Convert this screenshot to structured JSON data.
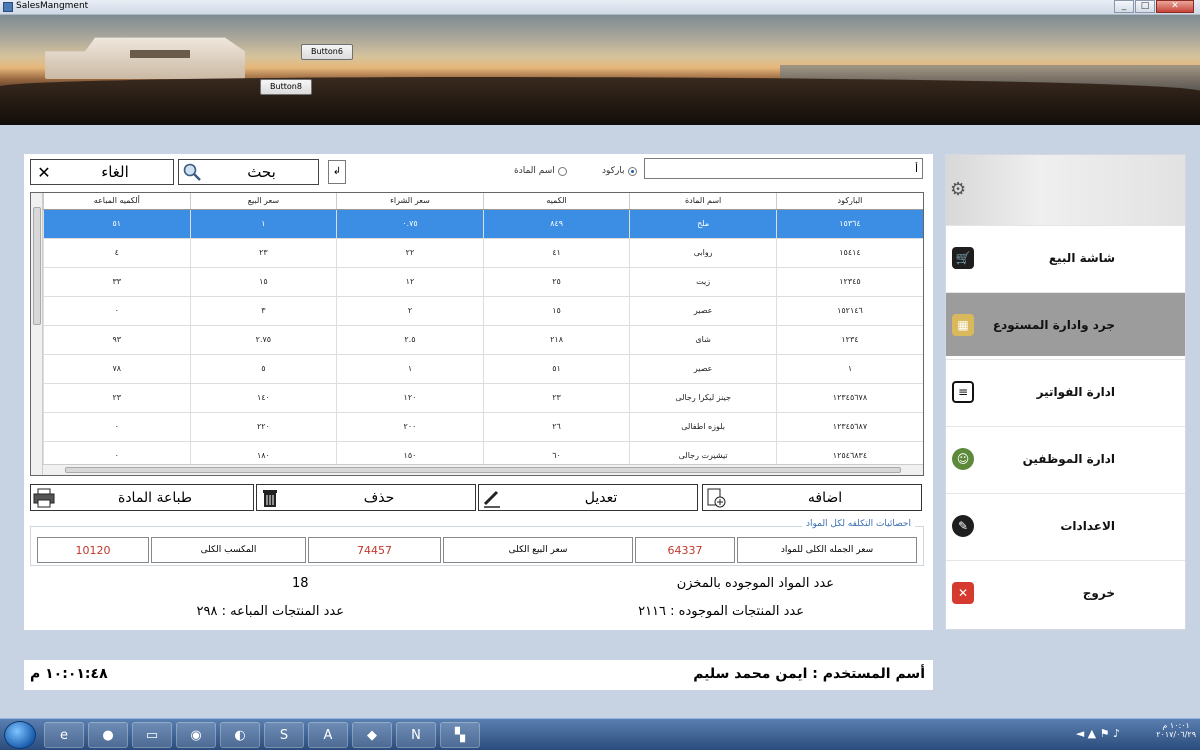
{
  "window": {
    "title": "SalesMangment",
    "controls": [
      "_",
      "□",
      "✕"
    ]
  },
  "header": {
    "button6_label": "Button6",
    "button8_label": "Button8"
  },
  "search": {
    "value": "أ",
    "radio_barcode": "باركود",
    "radio_name": "اسم المادة",
    "selected": "barcode",
    "search_label": "بحث",
    "cancel_label": "الغاء",
    "clear_label": "↲"
  },
  "table": {
    "columns": [
      "الباركود",
      "اسم المادة",
      "الكميه",
      "سعر الشراء",
      "سعر البيع",
      "ألكميه المباعه"
    ],
    "rows": [
      [
        "١٥٣٦٤",
        "ملح",
        "٨٤٩",
        "٠.٧٥",
        "١",
        "٥١"
      ],
      [
        "١٥٤١٤",
        "روابى",
        "٤١",
        "٢٢",
        "٢٣",
        "٤"
      ],
      [
        "١٢٣٤٥",
        "زيت",
        "٢٥",
        "١٢",
        "١٥",
        "٣٣"
      ],
      [
        "١٥٢١٤٦",
        "عصير",
        "١٥",
        "٢",
        "٣",
        "٠"
      ],
      [
        "١٢٣٤",
        "شاى",
        "٢١٨",
        "٢.٥",
        "٢.٧٥",
        "٩٣"
      ],
      [
        "١",
        "عصير",
        "٥١",
        "١",
        "٥",
        "٧٨"
      ],
      [
        "١٢٣٤٥٦٧٨",
        "جينز ليكرا رجالى",
        "٢٣",
        "١٢٠",
        "١٤٠",
        "٢٣"
      ],
      [
        "١٢٣٤٥٦٨٧",
        "بلوزه اطفالى",
        "٢٦",
        "٢٠٠",
        "٢٢٠",
        "٠"
      ],
      [
        "١٢٥٤٦٨٣٤",
        "تيشيرت رجالى",
        "٦٠",
        "١٥٠",
        "١٨٠",
        "٠"
      ]
    ],
    "selected_row": 0
  },
  "actions": {
    "add": "اضافه",
    "edit": "تعديل",
    "delete": "حذف",
    "print": "طباعة المادة"
  },
  "stats": {
    "legend": "احصائيات التكلفه لكل المواد",
    "total_cost_label": "سعر الجمله الكلى للمواد",
    "total_cost_value": "64337",
    "total_sell_label": "سعر البيع الكلى",
    "total_sell_value": "74457",
    "total_profit_label": "المكسب الكلى",
    "total_profit_value": "10120"
  },
  "info": {
    "items_in_store_label": "عدد المواد الموجوده بالمخزن",
    "items_in_store_value": "18",
    "existing_products": "عدد المنتجات الموجوده  : ٢١١٦",
    "sold_products": "عدد المنتجات المباعه : ٢٩٨"
  },
  "nav": {
    "items": [
      {
        "label": "شاشة البيع",
        "icon": "cart-icon"
      },
      {
        "label": "جرد وادارة المستودع",
        "icon": "inventory-icon"
      },
      {
        "label": "ادارة الفواتير",
        "icon": "invoice-icon"
      },
      {
        "label": "ادارة الموظفين",
        "icon": "employee-icon"
      },
      {
        "label": "الاعدادات",
        "icon": "wrench-icon"
      },
      {
        "label": "خروج",
        "icon": "exit-icon"
      }
    ],
    "active_index": 1
  },
  "status": {
    "user_label": "أسم المستخدم  :  ايمن محمد سليم",
    "clock": "١٠:٠١:٤٨ م"
  },
  "taskbar": {
    "time": "١٠:٠١ م",
    "date": "٢٠١٧/٠٦/٢٩"
  },
  "colors": {
    "selected_row": "#3c8ee5",
    "stat_value": "#c0392b",
    "active_nav": "#9c9c9c",
    "page_bg": "#c7d3e3"
  }
}
